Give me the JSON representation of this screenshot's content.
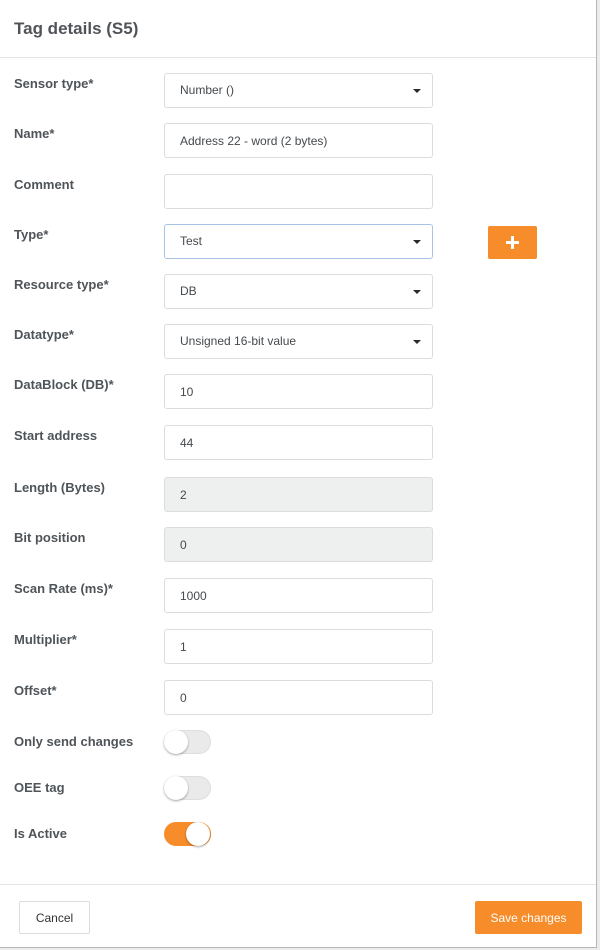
{
  "dialog": {
    "title": "Tag details (S5)"
  },
  "form": {
    "sensor_type": {
      "label": "Sensor type*",
      "value": "Number ()"
    },
    "name": {
      "label": "Name*",
      "value": "Address 22 - word (2 bytes)"
    },
    "comment": {
      "label": "Comment",
      "value": ""
    },
    "type": {
      "label": "Type*",
      "value": "Test"
    },
    "resource_type": {
      "label": "Resource type*",
      "value": "DB"
    },
    "datatype": {
      "label": "Datatype*",
      "value": "Unsigned 16-bit value"
    },
    "datablock": {
      "label": "DataBlock (DB)*",
      "value": "10"
    },
    "start_address": {
      "label": "Start address",
      "value": "44"
    },
    "length": {
      "label": "Length (Bytes)",
      "value": "2"
    },
    "bit_position": {
      "label": "Bit position",
      "value": "0"
    },
    "scan_rate": {
      "label": "Scan Rate (ms)*",
      "value": "1000"
    },
    "multiplier": {
      "label": "Multiplier*",
      "value": "1"
    },
    "offset": {
      "label": "Offset*",
      "value": "0"
    },
    "only_send_changes": {
      "label": "Only send changes",
      "on": false
    },
    "oee_tag": {
      "label": "OEE tag",
      "on": false
    },
    "is_active": {
      "label": "Is Active",
      "on": true
    }
  },
  "footer": {
    "cancel_label": "Cancel",
    "save_label": "Save changes"
  },
  "icons": {
    "add_type": "plus-icon",
    "dropdown": "caret-down-icon"
  },
  "colors": {
    "accent": "#f78c2a",
    "label": "#4f5459",
    "disabled_field": "#eef0f0"
  }
}
